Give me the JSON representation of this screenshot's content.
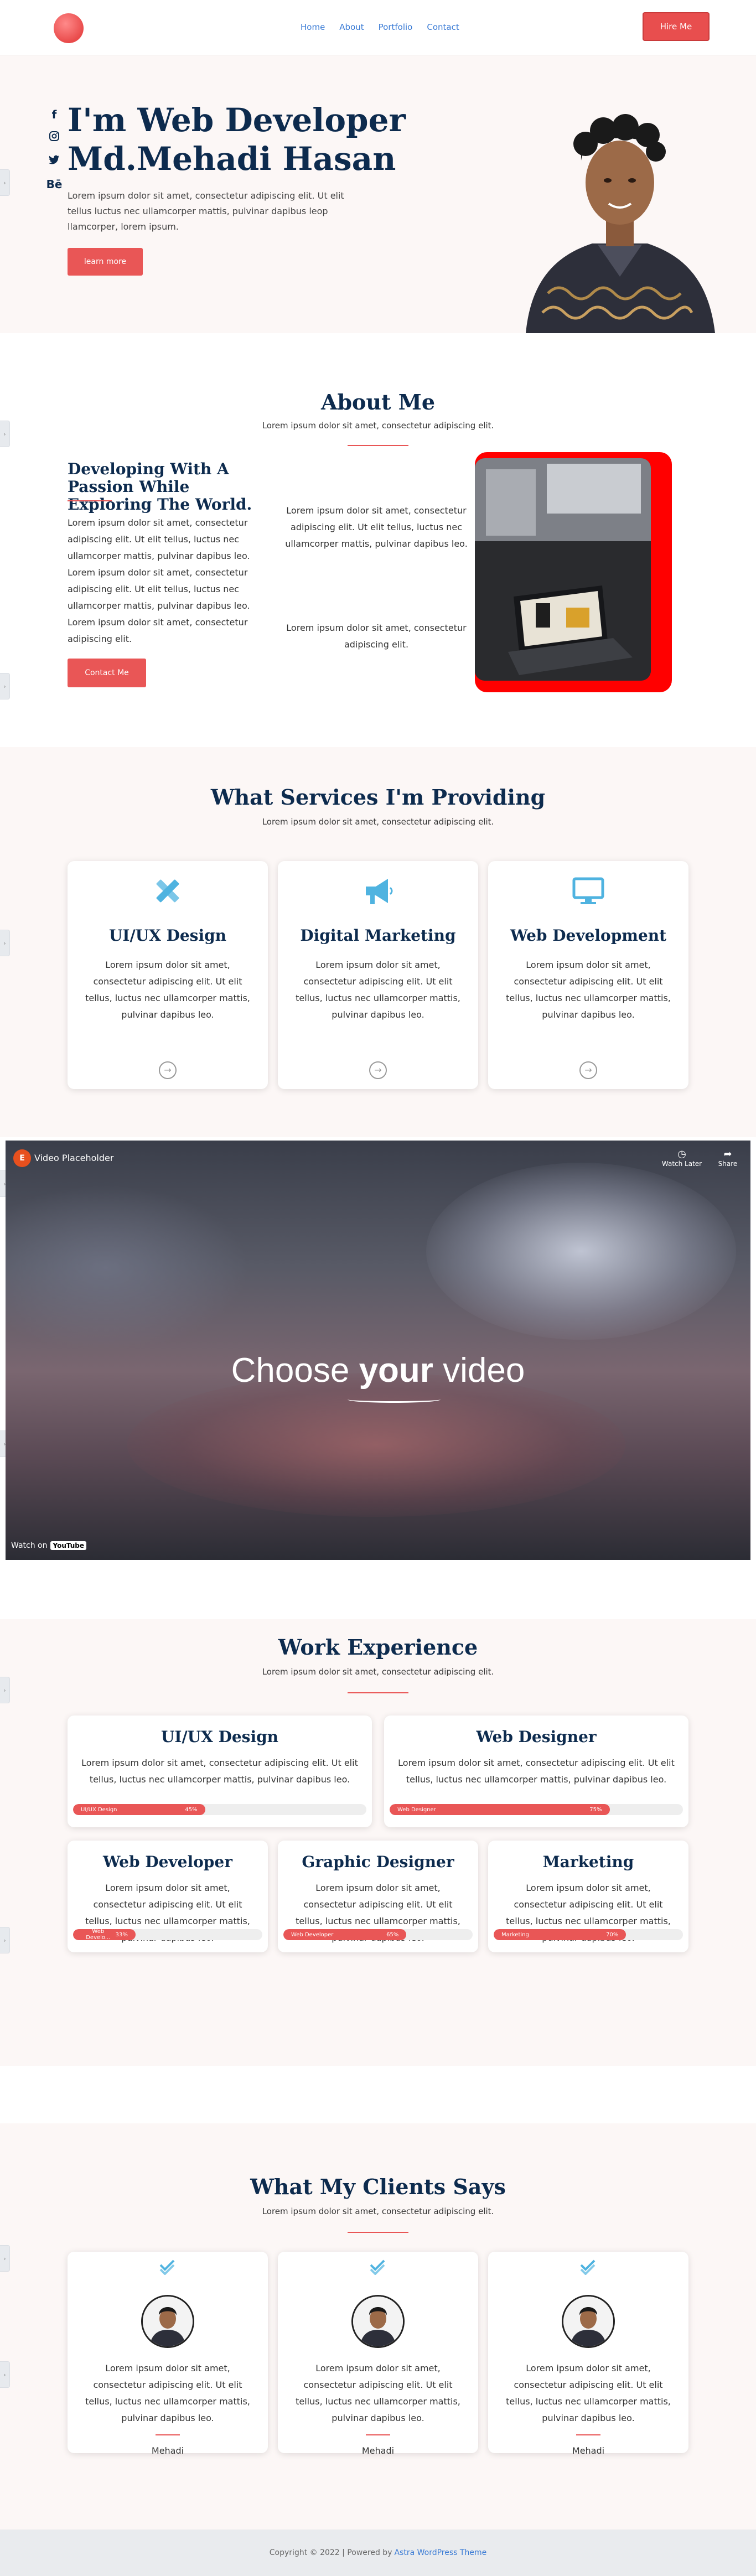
{
  "nav": {
    "items": [
      "Home",
      "About",
      "Portfolio",
      "Contact"
    ],
    "hire_label": "Hire Me"
  },
  "hero": {
    "socials": [
      "f",
      "ig",
      "tw",
      "Bē"
    ],
    "title_line1": "I'm Web Developer",
    "title_line2": "Md.Mehadi Hasan",
    "text": "Lorem ipsum dolor sit amet, consectetur adipiscing elit. Ut elit tellus luctus nec ullamcorper mattis, pulvinar dapibus leop llamcorper, lorem ipsum.",
    "button": "learn more"
  },
  "about": {
    "title": "About Me",
    "subtitle": "Lorem ipsum dolor sit amet, consectetur adipiscing elit.",
    "heading": "Developing With A Passion While Exploring The World.",
    "para1": "Lorem ipsum dolor sit amet, consectetur adipiscing elit. Ut elit tellus, luctus nec ullamcorper mattis, pulvinar dapibus leo. Lorem ipsum dolor sit amet, consectetur adipiscing elit. Ut elit tellus, luctus nec ullamcorper mattis, pulvinar dapibus leo. Lorem ipsum dolor sit amet, consectetur adipiscing elit.",
    "para2": "Lorem ipsum dolor sit amet, consectetur adipiscing elit. Ut elit tellus, luctus nec ullamcorper mattis, pulvinar dapibus leo.",
    "para3": "Lorem ipsum dolor sit amet, consectetur adipiscing elit.",
    "button": "Contact Me"
  },
  "services": {
    "title": "What Services I'm Providing",
    "subtitle": "Lorem ipsum dolor sit amet, consectetur adipiscing elit.",
    "items": [
      {
        "title": "UI/UX Design",
        "icon": "pencil-ruler-icon",
        "text": "Lorem ipsum dolor sit amet, consectetur adipiscing elit. Ut elit tellus, luctus nec ullamcorper mattis, pulvinar dapibus leo."
      },
      {
        "title": "Digital Marketing",
        "icon": "megaphone-icon",
        "text": "Lorem ipsum dolor sit amet, consectetur adipiscing elit. Ut elit tellus, luctus nec ullamcorper mattis, pulvinar dapibus leo."
      },
      {
        "title": "Web Development",
        "icon": "monitor-icon",
        "text": "Lorem ipsum dolor sit amet, consectetur adipiscing elit. Ut elit tellus, luctus nec ullamcorper mattis, pulvinar dapibus leo."
      }
    ]
  },
  "video": {
    "title": "Video Placeholder",
    "watch_later": "Watch Later",
    "share": "Share",
    "choose_pre": "Choose ",
    "choose_bold": "your",
    "choose_post": " video",
    "watch_on": "Watch on",
    "youtube": "YouTube"
  },
  "experience": {
    "title": "Work Experience",
    "subtitle": "Lorem ipsum dolor sit amet, consectetur adipiscing elit.",
    "items": [
      {
        "title": "UI/UX Design",
        "text": "Lorem ipsum dolor sit amet, consectetur adipiscing elit. Ut elit tellus, luctus nec ullamcorper mattis, pulvinar dapibus leo.",
        "bar_label": "UI/UX Design",
        "percent": "45%",
        "level": 0.45
      },
      {
        "title": "Web Designer",
        "text": "Lorem ipsum dolor sit amet, consectetur adipiscing elit. Ut elit tellus, luctus nec ullamcorper mattis, pulvinar dapibus leo.",
        "bar_label": "Web Designer",
        "percent": "75%",
        "level": 0.75
      },
      {
        "title": "Web Developer",
        "text": "Lorem ipsum dolor sit amet, consectetur adipiscing elit. Ut elit tellus, luctus nec ullamcorper mattis, pulvinar dapibus leo.",
        "bar_label": "Web Develo...",
        "percent": "33%",
        "level": 0.33
      },
      {
        "title": "Graphic Designer",
        "text": "Lorem ipsum dolor sit amet, consectetur adipiscing elit. Ut elit tellus, luctus nec ullamcorper mattis, pulvinar dapibus leo.",
        "bar_label": "Web Developer",
        "percent": "65%",
        "level": 0.65
      },
      {
        "title": "Marketing",
        "text": "Lorem ipsum dolor sit amet, consectetur adipiscing elit. Ut elit tellus, luctus nec ullamcorper mattis, pulvinar dapibus leo.",
        "bar_label": "Marketing",
        "percent": "70%",
        "level": 0.7
      }
    ]
  },
  "testimonials": {
    "title": "What My Clients Says",
    "subtitle": "Lorem ipsum dolor sit amet, consectetur adipiscing elit.",
    "items": [
      {
        "name": "Mehadi",
        "text": "Lorem ipsum dolor sit amet, consectetur adipiscing elit. Ut elit tellus, luctus nec ullamcorper mattis, pulvinar dapibus leo."
      },
      {
        "name": "Mehadi",
        "text": "Lorem ipsum dolor sit amet, consectetur adipiscing elit. Ut elit tellus, luctus nec ullamcorper mattis, pulvinar dapibus leo."
      },
      {
        "name": "Mehadi",
        "text": "Lorem ipsum dolor sit amet, consectetur adipiscing elit. Ut elit tellus, luctus nec ullamcorper mattis, pulvinar dapibus leo."
      }
    ]
  },
  "footer": {
    "text": "Copyright © 2022 | Powered by",
    "link": "Astra WordPress Theme"
  },
  "colors": {
    "accent": "#e95656",
    "heading": "#0d2b4e",
    "link": "#3a7bd5",
    "icon": "#4fb3e0",
    "about_frame": "#ff0000"
  }
}
